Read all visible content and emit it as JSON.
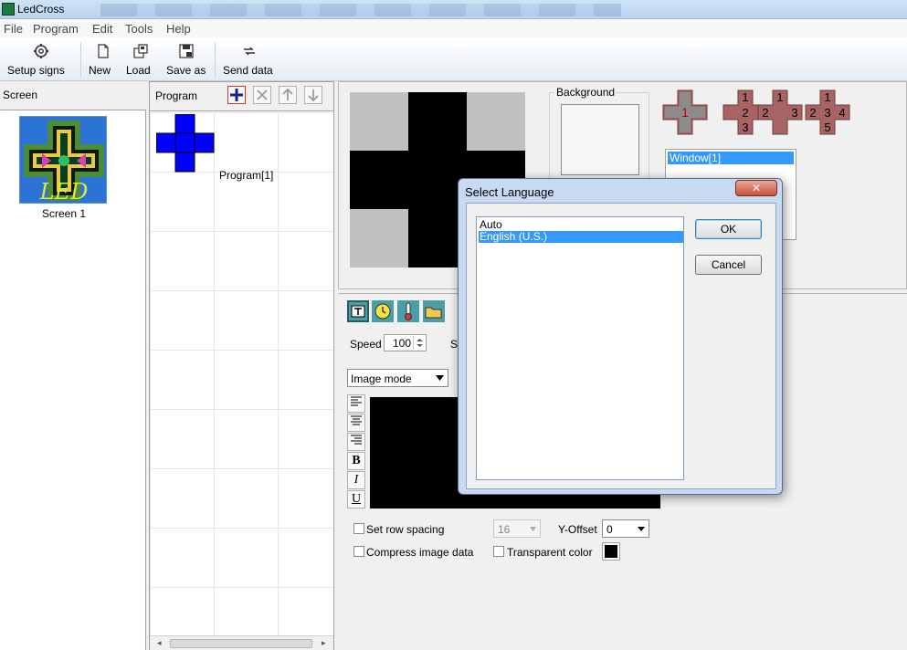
{
  "window": {
    "title": "LedCross"
  },
  "menu": {
    "items": [
      "File",
      "Program",
      "Edit",
      "Tools",
      "Help"
    ]
  },
  "toolbar": {
    "setup_signs": "Setup signs",
    "new": "New",
    "load": "Load",
    "save_as": "Save as",
    "send_data": "Send data"
  },
  "screen_panel": {
    "header": "Screen",
    "screen_name": "Screen 1",
    "thumb_text": "LED"
  },
  "program_panel": {
    "header": "Program",
    "program_name": "Program[1]"
  },
  "preview": {
    "background_label": "Background",
    "layout_numbers": [
      "1",
      "1",
      "2",
      "3",
      "1",
      "2",
      "3",
      "1",
      "2",
      "3",
      "4",
      "5"
    ],
    "window_item": "Window[1]"
  },
  "editor": {
    "speed_label": "Speed",
    "speed_value": "100",
    "mode": "Image mode",
    "format_buttons": [
      "B",
      "I",
      "U"
    ],
    "set_row_spacing": "Set row spacing",
    "row_spacing_value": "16",
    "y_offset_label": "Y-Offset",
    "y_offset_value": "0",
    "compress_image": "Compress image data",
    "transparent_color": "Transparent color",
    "transparent_color_value": "#000000"
  },
  "dialog": {
    "title": "Select Language",
    "close_glyph": "✕",
    "languages": [
      "Auto",
      "English (U.S.)"
    ],
    "selected_language": "English (U.S.)",
    "ok": "OK",
    "cancel": "Cancel"
  },
  "colors": {
    "selection": "#3399ff",
    "program_cross": "#0000ff",
    "layout_icon": "#a86464",
    "layout_number": "#c00000"
  }
}
